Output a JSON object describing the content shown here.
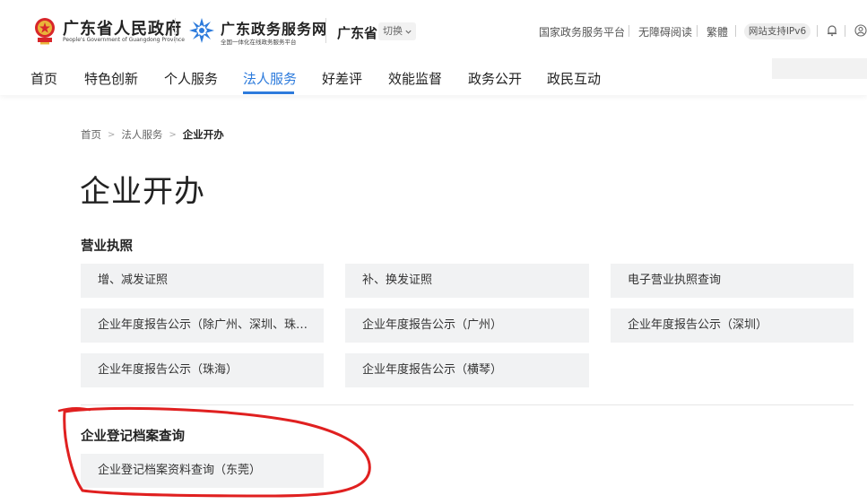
{
  "header": {
    "gov_name": "广东省人民政府",
    "gov_subtitle": "People's Government of Guangdong Province",
    "service_name": "广东政务服务网",
    "service_subtitle": "全国一体化在线政务服务平台",
    "province": "广东省",
    "switch_label": "切换",
    "links": [
      "国家政务服务平台",
      "无障碍阅读",
      "繁體"
    ],
    "ipv6_label": "网站支持IPv6",
    "icons": [
      "emblem-icon",
      "service-logo-icon",
      "chevron-down-icon",
      "bell-icon",
      "user-icon"
    ]
  },
  "nav": {
    "items": [
      "首页",
      "特色创新",
      "个人服务",
      "法人服务",
      "好差评",
      "效能监督",
      "政务公开",
      "政民互动"
    ],
    "active": "法人服务",
    "accent_color": "#2d7bdc"
  },
  "breadcrumb": [
    "首页",
    "法人服务",
    "企业开办"
  ],
  "page_title": "企业开办",
  "sections": [
    {
      "title": "营业执照",
      "items": [
        "增、减发证照",
        "补、换发证照",
        "电子营业执照查询",
        "企业年度报告公示（除广州、深圳、珠…",
        "企业年度报告公示（广州）",
        "企业年度报告公示（深圳）",
        "企业年度报告公示（珠海）",
        "企业年度报告公示（横琴）"
      ]
    },
    {
      "title": "企业登记档案查询",
      "items": [
        "企业登记档案资料查询（东莞）"
      ]
    }
  ],
  "annotation_color": "#e02020"
}
